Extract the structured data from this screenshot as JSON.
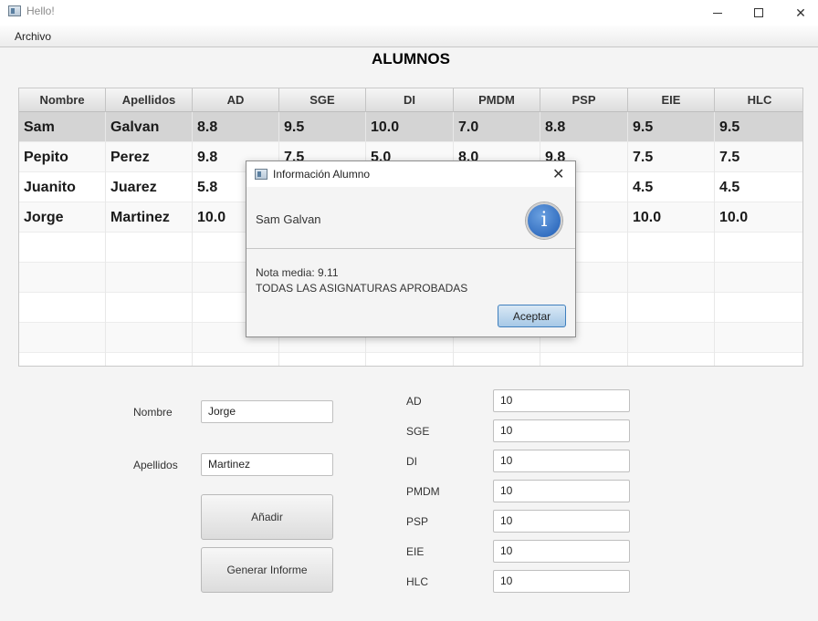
{
  "window": {
    "title": "Hello!"
  },
  "menu": {
    "items": [
      "Archivo"
    ]
  },
  "page": {
    "title": "ALUMNOS"
  },
  "table": {
    "headers": [
      "Nombre",
      "Apellidos",
      "AD",
      "SGE",
      "DI",
      "PMDM",
      "PSP",
      "EIE",
      "HLC"
    ],
    "rows": [
      [
        "Sam",
        "Galvan",
        "8.8",
        "9.5",
        "10.0",
        "7.0",
        "8.8",
        "9.5",
        "9.5"
      ],
      [
        "Pepito",
        "Perez",
        "9.8",
        "7.5",
        "5.0",
        "8.0",
        "9.8",
        "7.5",
        "7.5"
      ],
      [
        "Juanito",
        "Juarez",
        "5.8",
        "",
        "",
        "",
        "",
        "4.5",
        "4.5"
      ],
      [
        "Jorge",
        "Martinez",
        "10.0",
        "",
        "",
        "",
        "",
        "10.0",
        "10.0"
      ]
    ]
  },
  "form": {
    "nombre_label": "Nombre",
    "nombre_value": "Jorge",
    "apellidos_label": "Apellidos",
    "apellidos_value": "Martinez",
    "add_button": "Añadir",
    "report_button": "Generar Informe",
    "grades": [
      {
        "label": "AD",
        "value": "10"
      },
      {
        "label": "SGE",
        "value": "10"
      },
      {
        "label": "DI",
        "value": "10"
      },
      {
        "label": "PMDM",
        "value": "10"
      },
      {
        "label": "PSP",
        "value": "10"
      },
      {
        "label": "EIE",
        "value": "10"
      },
      {
        "label": "HLC",
        "value": "10"
      }
    ]
  },
  "dialog": {
    "title": "Información Alumno",
    "header": "Sam Galvan",
    "line1": "Nota media: 9.11",
    "line2": "TODAS LAS ASIGNATURAS APROBADAS",
    "ok_button": "Aceptar",
    "icon": "info-icon"
  }
}
